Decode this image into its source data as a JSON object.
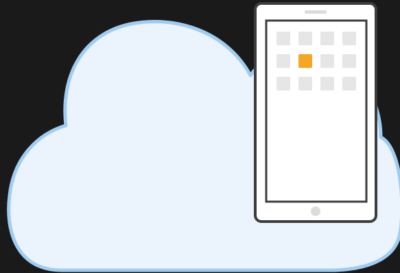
{
  "scene": {
    "background_color": "#1a1a1a",
    "cloud": {
      "icon": "cloud-icon",
      "fill_color": "#ebf3fc",
      "outline_color": "#9fcdf2"
    },
    "phone": {
      "icon": "smartphone-icon",
      "body_color": "#ffffff",
      "frame_color": "#3d3d3d",
      "speaker_color": "#dcdcdc",
      "home_button_color": "#dcdcdc",
      "screen": {
        "app_tile_color": "#e6e6e6",
        "highlight_tile_color": "#f5a623",
        "grid_rows": 3,
        "grid_columns": 4,
        "highlighted_tile": {
          "row": 2,
          "column": 2
        }
      }
    }
  }
}
